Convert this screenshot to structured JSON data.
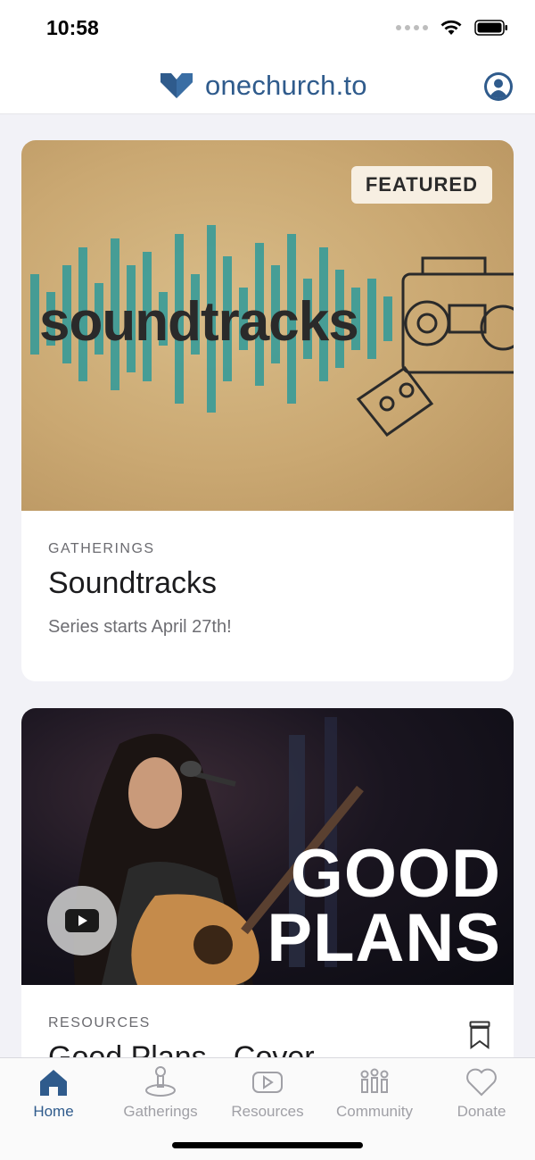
{
  "status_bar": {
    "time": "10:58"
  },
  "header": {
    "logo_text": "onechurch.to",
    "brand_color": "#2f5b8c",
    "profile_icon": "user-circle-icon"
  },
  "feed": {
    "featured_card": {
      "badge": "FEATURED",
      "art_wordmark": "soundtracks",
      "category": "GATHERINGS",
      "title": "Soundtracks",
      "subtitle": "Series starts April 27th!"
    },
    "video_card": {
      "art_title_line1": "GOOD",
      "art_title_line2": "PLANS",
      "category": "RESOURCES",
      "title": "Good Plans - Cover",
      "play_icon": "play-icon",
      "bookmark_icon": "bookmark-icon"
    }
  },
  "tab_bar": {
    "tabs": [
      {
        "label": "Home",
        "icon": "home-icon",
        "active": true
      },
      {
        "label": "Gatherings",
        "icon": "gatherings-icon",
        "active": false
      },
      {
        "label": "Resources",
        "icon": "video-play-icon",
        "active": false
      },
      {
        "label": "Community",
        "icon": "people-icon",
        "active": false
      },
      {
        "label": "Donate",
        "icon": "heart-icon",
        "active": false
      }
    ]
  }
}
